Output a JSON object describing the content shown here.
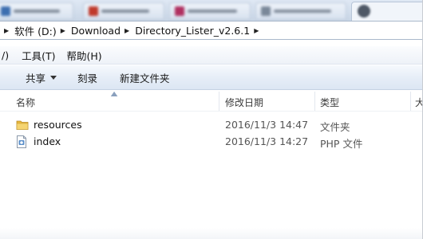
{
  "address": {
    "crumbs": [
      "软件 (D:)",
      "Download",
      "Directory_Lister_v2.6.1"
    ]
  },
  "menu": {
    "items": [
      {
        "label": "/)"
      },
      {
        "label": "工具(T)"
      },
      {
        "label": "帮助(H)"
      }
    ]
  },
  "toolbar": {
    "share_label": "共享",
    "burn_label": "刻录",
    "new_folder_label": "新建文件夹"
  },
  "columns": {
    "name": "名称",
    "date": "修改日期",
    "type": "类型",
    "size": "大"
  },
  "files": [
    {
      "name": "resources",
      "date": "2016/11/3 14:47",
      "type": "文件夹",
      "icon": "folder-icon"
    },
    {
      "name": "index",
      "date": "2016/11/3 14:27",
      "type": "PHP 文件",
      "icon": "php-file-icon"
    }
  ],
  "colors": {
    "folder": "#e8b83a",
    "selection_bar": "#dce6f3"
  }
}
